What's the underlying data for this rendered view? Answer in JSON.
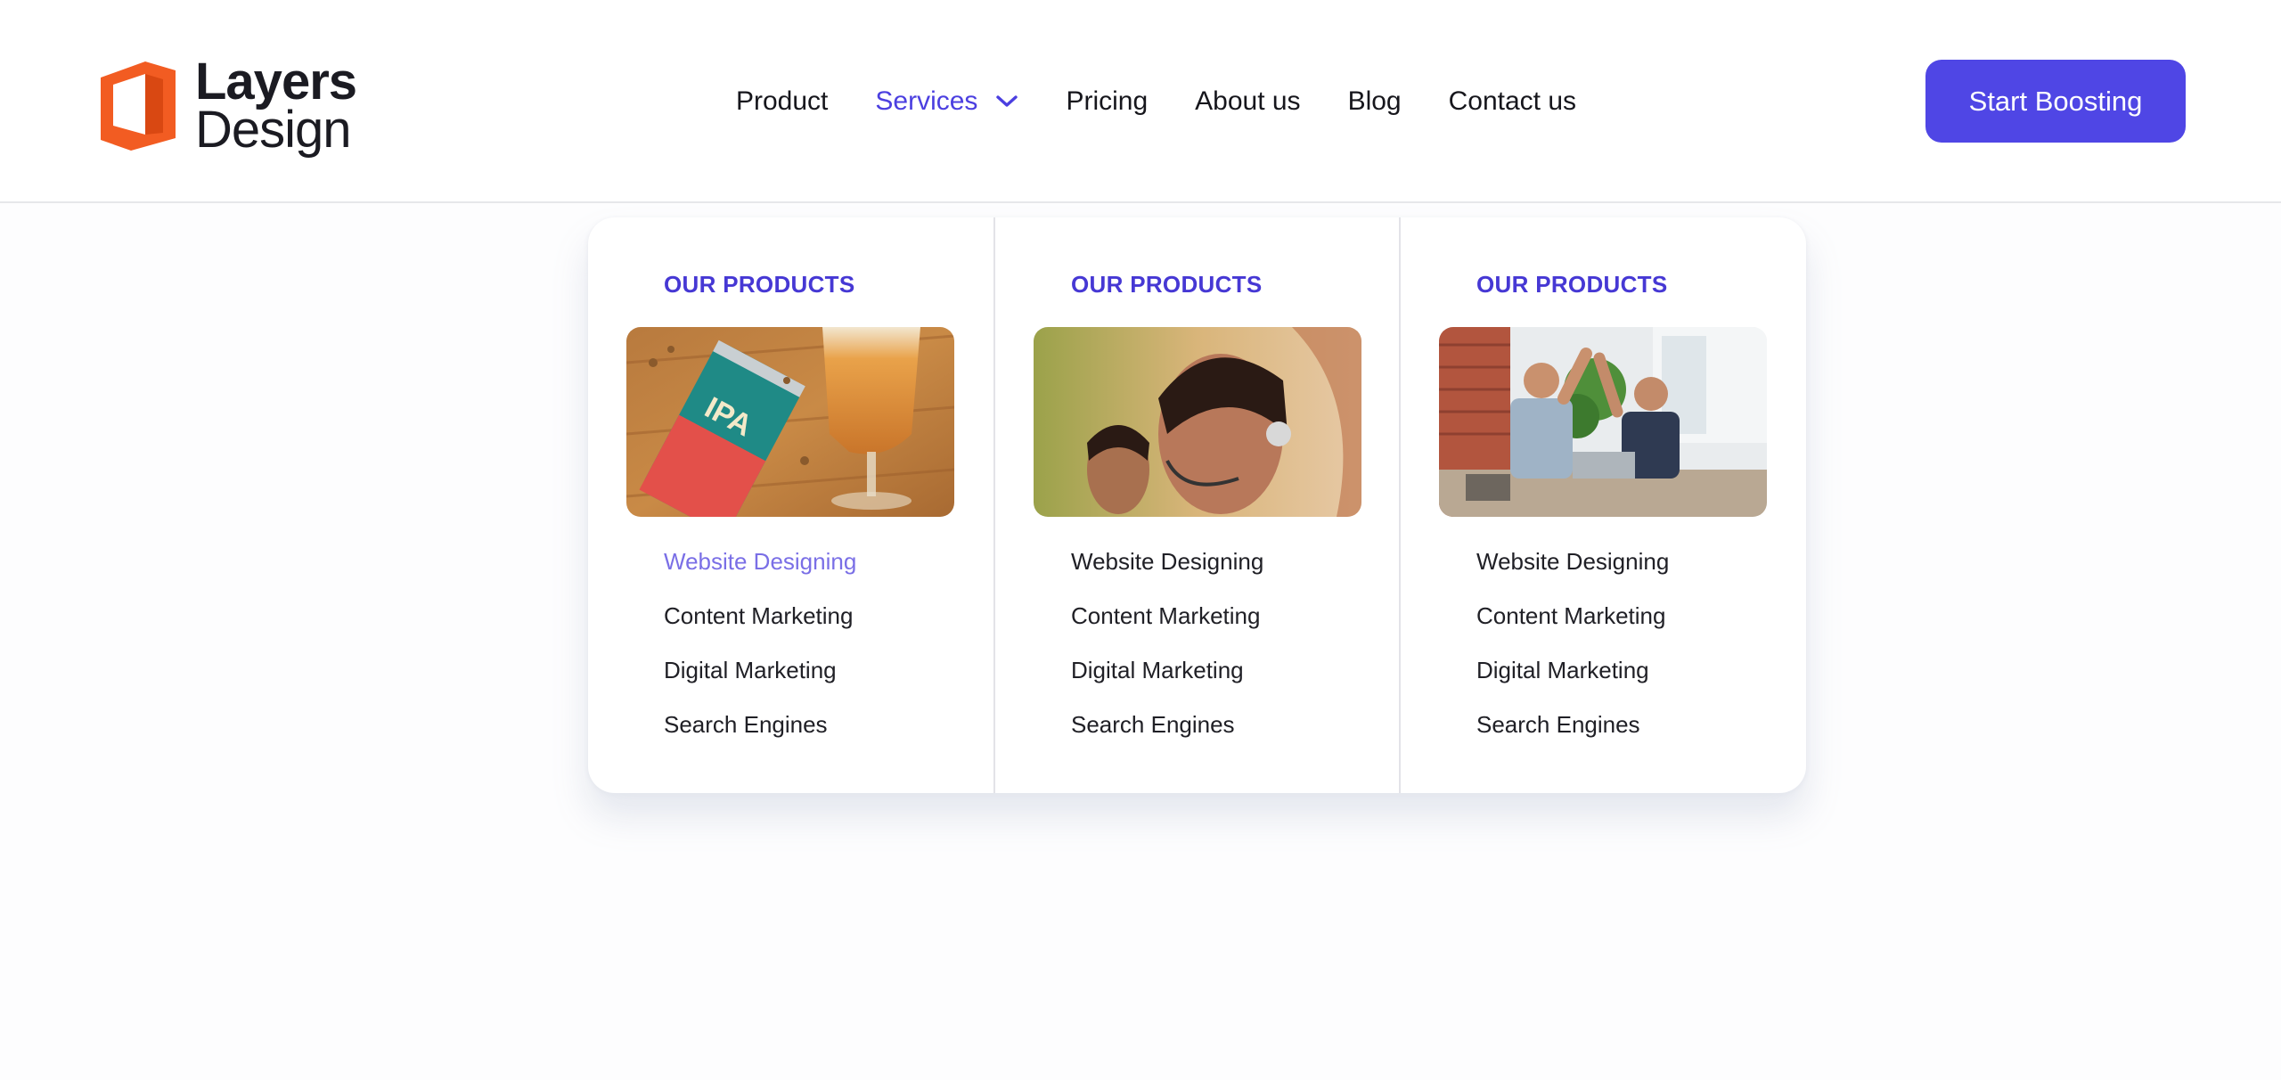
{
  "logo": {
    "line1": "Layers",
    "line2": "Design",
    "icon": "layers-logo-icon",
    "color": "#f25c22"
  },
  "nav": {
    "items": [
      {
        "label": "Product"
      },
      {
        "label": "Services",
        "active": true,
        "icon": "chevron-down-icon"
      },
      {
        "label": "Pricing"
      },
      {
        "label": "About us"
      },
      {
        "label": "Blog"
      },
      {
        "label": "Contact us"
      }
    ]
  },
  "cta": {
    "label": "Start Boosting",
    "color": "#4f46e5"
  },
  "dropdown": {
    "columns": [
      {
        "heading": "OUR PRODUCTS",
        "image": "beer-can-photo",
        "links": [
          "Website Designing",
          "Content Marketing",
          "Digital Marketing",
          "Search Engines"
        ],
        "highlighted": "Website Designing"
      },
      {
        "heading": "OUR PRODUCTS",
        "image": "call-center-photo",
        "links": [
          "Website Designing",
          "Content Marketing",
          "Digital Marketing",
          "Search Engines"
        ]
      },
      {
        "heading": "OUR PRODUCTS",
        "image": "office-high-five-photo",
        "links": [
          "Website Designing",
          "Content Marketing",
          "Digital Marketing",
          "Search Engines"
        ]
      }
    ]
  },
  "colors": {
    "accent": "#4b3fe0",
    "link_highlight": "#7a6fe6"
  }
}
